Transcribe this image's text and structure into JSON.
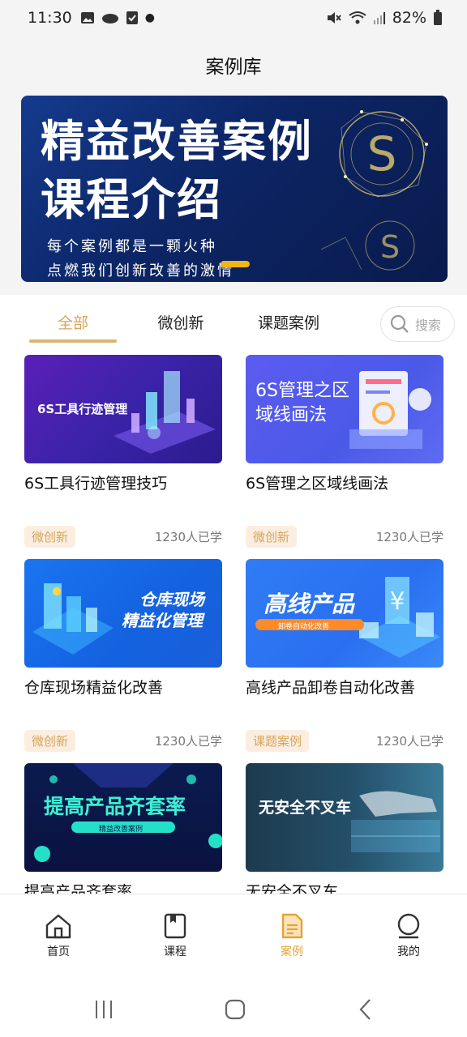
{
  "status": {
    "time": "11:30",
    "battery": "82%"
  },
  "header": {
    "title": "案例库"
  },
  "banner": {
    "title_line1": "精益改善案例",
    "title_line2": "课程介绍",
    "subtitle_line1": "每个案例都是一颗火种",
    "subtitle_line2": "点燃我们创新改善的激情"
  },
  "tabs": [
    {
      "label": "全部",
      "active": true
    },
    {
      "label": "微创新",
      "active": false
    },
    {
      "label": "课题案例",
      "active": false
    }
  ],
  "search": {
    "placeholder": "搜索"
  },
  "cards": [
    {
      "title": "6S工具行迹管理技巧",
      "thumb_text": "6S工具行迹管理"
    },
    {
      "title": "6S管理之区域线画法",
      "thumb_text_1": "6S管理之区",
      "thumb_text_2": "域线画法"
    },
    {
      "title": "仓库现场精益化改善",
      "badge": "微创新",
      "learned": "1230人已学",
      "thumb_text_1": "仓库现场",
      "thumb_text_2": "精益化管理"
    },
    {
      "title": "高线产品卸卷自动化改善",
      "badge": "微创新",
      "learned": "1230人已学",
      "thumb_text_1": "高线产品",
      "thumb_text_2": "卸卷自动化改善"
    },
    {
      "title": "提高产品齐套率",
      "badge": "微创新",
      "learned": "1230人已学",
      "thumb_text_1": "提高产品齐套率",
      "thumb_text_2": "精益改善案例"
    },
    {
      "title": "无安全不叉车",
      "badge": "课题案例",
      "learned": "1230人已学",
      "thumb_text": "无安全不叉车"
    }
  ],
  "nav": [
    {
      "label": "首页",
      "icon": "home-icon",
      "active": false
    },
    {
      "label": "课程",
      "icon": "book-icon",
      "active": false
    },
    {
      "label": "案例",
      "icon": "document-icon",
      "active": true
    },
    {
      "label": "我的",
      "icon": "profile-icon",
      "active": false
    }
  ],
  "colors": {
    "accent": "#d6a55a",
    "nav_active": "#e4a33a",
    "badge_bg": "#fbeee0"
  }
}
